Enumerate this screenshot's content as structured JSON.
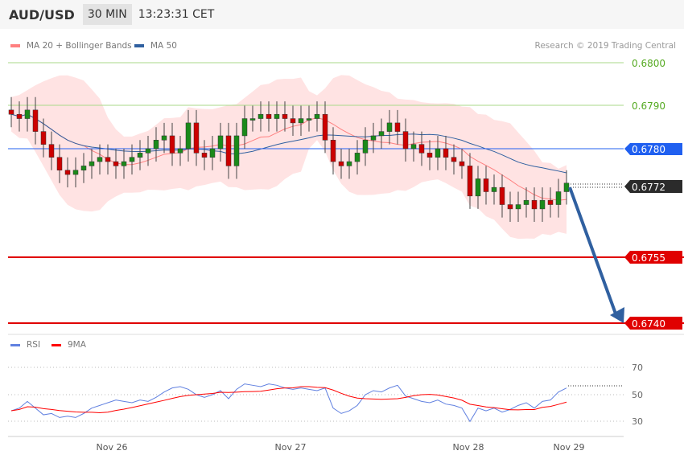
{
  "header": {
    "symbol": "AUD/USD",
    "timeframe": "30 MIN",
    "time": "13:23:31 CET"
  },
  "legend": {
    "ma20": "MA 20 + Bollinger Bands",
    "ma50": "MA 50",
    "rsi": "RSI",
    "ma9": "9MA"
  },
  "copyright": "Research © 2019 Trading Central",
  "colors": {
    "ma20": "#ff8080",
    "ma50": "#3060a0",
    "rsi": "#6080e0",
    "ma9": "#ff0000",
    "bull": "#1a8a1a",
    "bear": "#cc0000",
    "pivot": "#2060f0",
    "target": "#e00000",
    "resist": "#66bb33"
  },
  "levels": {
    "r2": "0.6800",
    "r1": "0.6790",
    "pivot": "0.6780",
    "last": "0.6772",
    "s1": "0.6755",
    "s2": "0.6740"
  },
  "chart_data": {
    "type": "candlestick",
    "closes": [
      0.6788,
      0.6787,
      0.6789,
      0.6784,
      0.6781,
      0.6778,
      0.6775,
      0.6774,
      0.6775,
      0.6776,
      0.6777,
      0.6778,
      0.6777,
      0.6776,
      0.6777,
      0.6778,
      0.6779,
      0.678,
      0.6782,
      0.6783,
      0.6779,
      0.678,
      0.6786,
      0.6779,
      0.6778,
      0.678,
      0.6783,
      0.6776,
      0.6783,
      0.6787,
      0.6787,
      0.6788,
      0.6787,
      0.6788,
      0.6787,
      0.6786,
      0.6787,
      0.6787,
      0.6788,
      0.6782,
      0.6777,
      0.6776,
      0.6777,
      0.6779,
      0.6782,
      0.6783,
      0.6784,
      0.6786,
      0.6784,
      0.678,
      0.6781,
      0.6779,
      0.6778,
      0.678,
      0.6778,
      0.6777,
      0.6776,
      0.6769,
      0.6773,
      0.677,
      0.6771,
      0.6767,
      0.6766,
      0.6767,
      0.6768,
      0.6766,
      0.6768,
      0.6767,
      0.677,
      0.6772
    ],
    "rsi": [
      38,
      40,
      45,
      40,
      35,
      36,
      33,
      34,
      33,
      36,
      40,
      42,
      44,
      46,
      45,
      44,
      46,
      45,
      48,
      52,
      55,
      56,
      54,
      50,
      48,
      50,
      53,
      47,
      54,
      58,
      57,
      56,
      58,
      57,
      55,
      54,
      55,
      54,
      53,
      55,
      40,
      36,
      38,
      42,
      50,
      53,
      52,
      55,
      57,
      49,
      47,
      45,
      44,
      46,
      43,
      42,
      40,
      30,
      40,
      38,
      40,
      37,
      39,
      42,
      44,
      40,
      45,
      46,
      52,
      55
    ],
    "x_labels": [
      "Nov 26",
      "Nov 27",
      "Nov 28",
      "Nov 29"
    ],
    "rsi_ticks": [
      "70",
      "50",
      "30"
    ],
    "ylim": [
      0.6735,
      0.6805
    ],
    "forecast": {
      "from": 0.6772,
      "to": 0.674
    }
  }
}
